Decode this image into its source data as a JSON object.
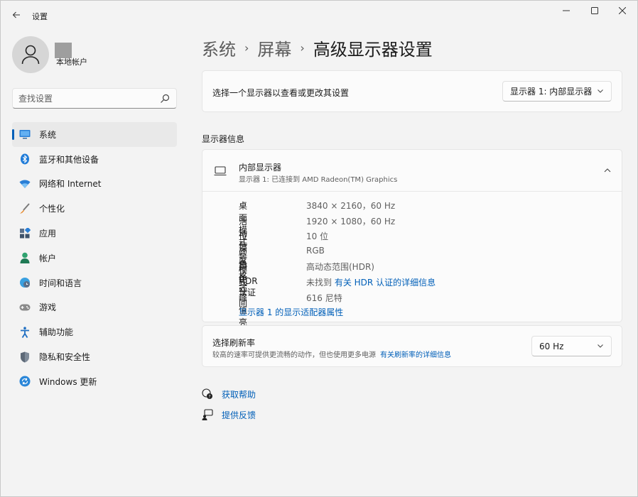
{
  "window": {
    "title": "设置",
    "back_icon": "arrow-left-icon",
    "minimize_icon": "minimize-icon",
    "maximize_icon": "maximize-icon",
    "close_icon": "close-icon"
  },
  "profile": {
    "name": "本地帐户"
  },
  "search": {
    "placeholder": "查找设置"
  },
  "sidebar": {
    "items": [
      {
        "label": "系统",
        "icon": "display-icon",
        "active": true
      },
      {
        "label": "蓝牙和其他设备",
        "icon": "bluetooth-icon"
      },
      {
        "label": "网络和 Internet",
        "icon": "wifi-icon"
      },
      {
        "label": "个性化",
        "icon": "brush-icon"
      },
      {
        "label": "应用",
        "icon": "apps-icon"
      },
      {
        "label": "帐户",
        "icon": "person-icon"
      },
      {
        "label": "时间和语言",
        "icon": "globe-clock-icon"
      },
      {
        "label": "游戏",
        "icon": "gamepad-icon"
      },
      {
        "label": "辅助功能",
        "icon": "accessibility-icon"
      },
      {
        "label": "隐私和安全性",
        "icon": "shield-icon"
      },
      {
        "label": "Windows 更新",
        "icon": "update-icon"
      }
    ],
    "accent": "#005fb8"
  },
  "breadcrumb": {
    "items": [
      "系统",
      "屏幕"
    ],
    "current": "高级显示器设置",
    "separator": "›"
  },
  "display_select": {
    "label": "选择一个显示器以查看或更改其设置",
    "value": "显示器 1: 内部显示器"
  },
  "display_info": {
    "section_title": "显示器信息",
    "title": "内部显示器",
    "subtitle": "显示器 1: 已连接到 AMD Radeon(TM) Graphics",
    "rows": [
      {
        "key": "桌面模式",
        "value": "3840 × 2160，60 Hz"
      },
      {
        "key": "活动信号模式",
        "value": "1920 × 1080，60 Hz"
      },
      {
        "key": "位深度",
        "value": "10 位"
      },
      {
        "key": "颜色格式",
        "value": "RGB"
      },
      {
        "key": "颜色空间",
        "value": "高动态范围(HDR)"
      },
      {
        "key": "HDR 认证",
        "value": "未找到",
        "link": "有关 HDR 认证的详细信息"
      },
      {
        "key": "峰值亮度",
        "value": "616 尼特"
      }
    ],
    "adapter_link": "显示器 1 的显示适配器属性"
  },
  "refresh": {
    "title": "选择刷新率",
    "description": "较高的速率可提供更流畅的动作，但也使用更多电源",
    "link": "有关刷新率的详细信息",
    "value": "60 Hz"
  },
  "help": {
    "get_help": "获取帮助",
    "feedback": "提供反馈"
  }
}
